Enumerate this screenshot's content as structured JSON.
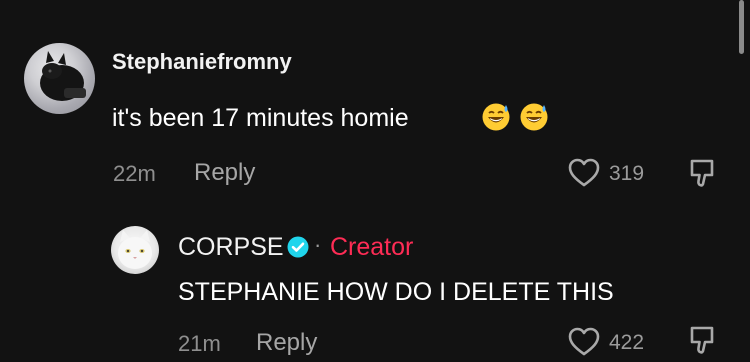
{
  "comments": [
    {
      "username": "Stephaniefromny",
      "text": "it's been 17 minutes homie",
      "emoji": [
        "grinning-face-with-sweat",
        "grinning-face-with-sweat"
      ],
      "timestamp": "22m",
      "reply_label": "Reply",
      "likes": "319"
    },
    {
      "username": "CORPSE",
      "verified": true,
      "separator": "·",
      "tag": "Creator",
      "text": "STEPHANIE HOW DO I DELETE THIS",
      "timestamp": "21m",
      "reply_label": "Reply",
      "likes": "422"
    }
  ],
  "colors": {
    "background": "#121212",
    "creator_tag": "#fe2c55",
    "verified_badge": "#20d5ec",
    "muted_text": "#8f8f8f"
  },
  "icons": [
    "heart-icon",
    "dislike-icon",
    "verified-badge-icon",
    "emoji-icon"
  ]
}
